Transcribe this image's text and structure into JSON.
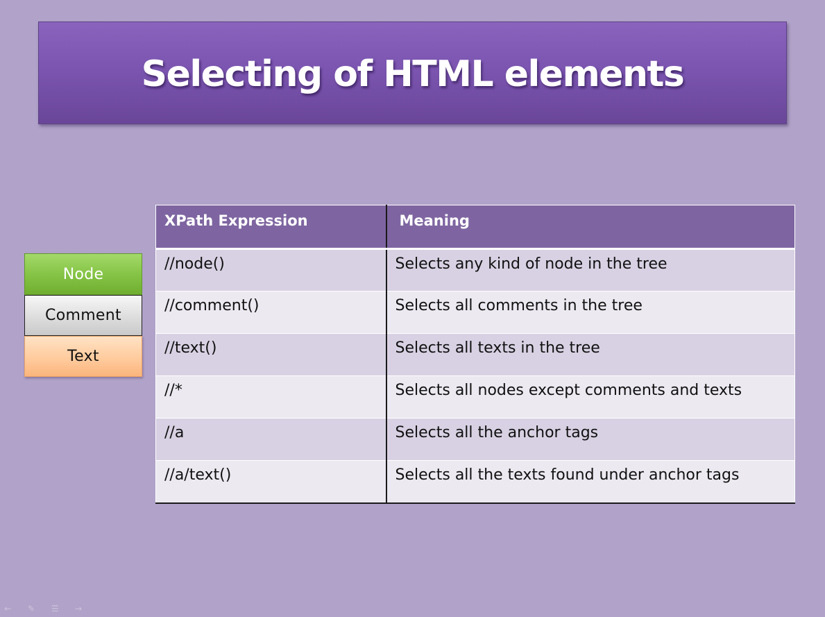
{
  "slide": {
    "title": "Selecting of HTML elements"
  },
  "legend": {
    "items": [
      "Node",
      "Comment",
      "Text"
    ]
  },
  "table": {
    "headers": [
      "XPath Expression",
      "Meaning"
    ],
    "rows": [
      [
        "//node()",
        "Selects any kind of node in the tree"
      ],
      [
        "//comment()",
        "Selects all comments in the tree"
      ],
      [
        "//text()",
        "Selects all texts in the tree"
      ],
      [
        "//*",
        "Selects all nodes except comments and texts"
      ],
      [
        "//a",
        "Selects all the anchor tags"
      ],
      [
        "//a/text()",
        "Selects all the texts found under anchor tags"
      ]
    ]
  },
  "slide_nav": {
    "icons": [
      "previous-slide-icon",
      "pen-icon",
      "slide-menu-icon",
      "next-slide-icon"
    ]
  },
  "colors": {
    "background": "#b0a2c8",
    "title_banner": "#7b55b0",
    "table_header": "#7e65a1",
    "row_odd": "#d8d1e3",
    "row_even": "#ece9f1",
    "node_box": "#85c446",
    "comment_box": "#dddddd",
    "text_box": "#ffc99a"
  }
}
